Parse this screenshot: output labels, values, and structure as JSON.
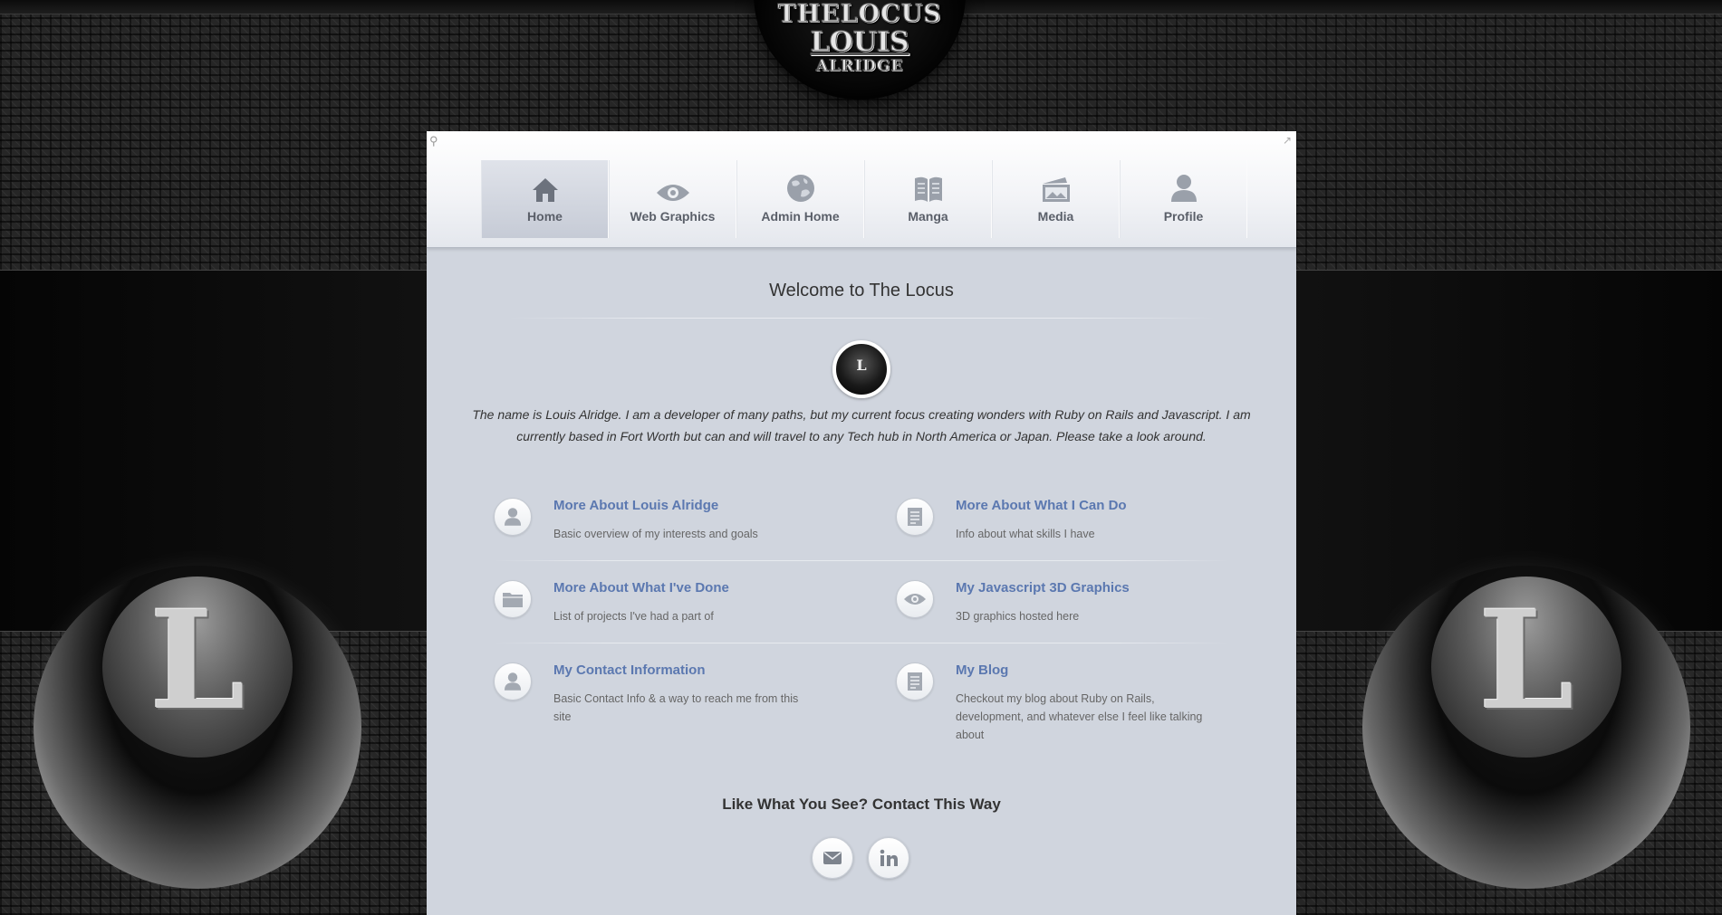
{
  "brand": {
    "line1": "THELOCUS",
    "line2": "LOUIS",
    "line3": "ALRIDGE",
    "emblem_letter": "L"
  },
  "nav": {
    "items": [
      {
        "label": "Home",
        "icon": "home-icon",
        "active": true
      },
      {
        "label": "Web Graphics",
        "icon": "eye-icon"
      },
      {
        "label": "Admin Home",
        "icon": "globe-icon"
      },
      {
        "label": "Manga",
        "icon": "book-icon"
      },
      {
        "label": "Media",
        "icon": "picture-icon"
      },
      {
        "label": "Profile",
        "icon": "user-icon"
      }
    ]
  },
  "main": {
    "title": "Welcome to The Locus",
    "avatar_letter": "L",
    "intro": "The name is Louis Alridge. I am a developer of many paths, but my current focus creating wonders with Ruby on Rails and Javascript. I am currently based in Fort Worth but can and will travel to any Tech hub in North America or Japan. Please take a look around.",
    "features": [
      {
        "title": "More About Louis Alridge",
        "desc": "Basic overview of my interests and goals",
        "icon": "user-icon"
      },
      {
        "title": "More About What I Can Do",
        "desc": "Info about what skills I have",
        "icon": "document-icon"
      },
      {
        "title": "More About What I've Done",
        "desc": "List of projects I've had a part of",
        "icon": "folder-icon"
      },
      {
        "title": "My Javascript 3D Graphics",
        "desc": "3D graphics hosted here",
        "icon": "eye-icon"
      },
      {
        "title": "My Contact Information",
        "desc": "Basic Contact Info & a way to reach me from this site",
        "icon": "user-icon"
      },
      {
        "title": "My Blog",
        "desc": "Checkout my blog about Ruby on Rails, development, and whatever else I feel like talking about",
        "icon": "document-icon"
      }
    ],
    "contact_title": "Like What You See? Contact This Way",
    "social": [
      {
        "name": "email-icon"
      },
      {
        "name": "linkedin-icon"
      }
    ]
  },
  "colors": {
    "link": "#5b78b0",
    "panel": "#d0d5de",
    "nav_text": "#5a5f69"
  }
}
